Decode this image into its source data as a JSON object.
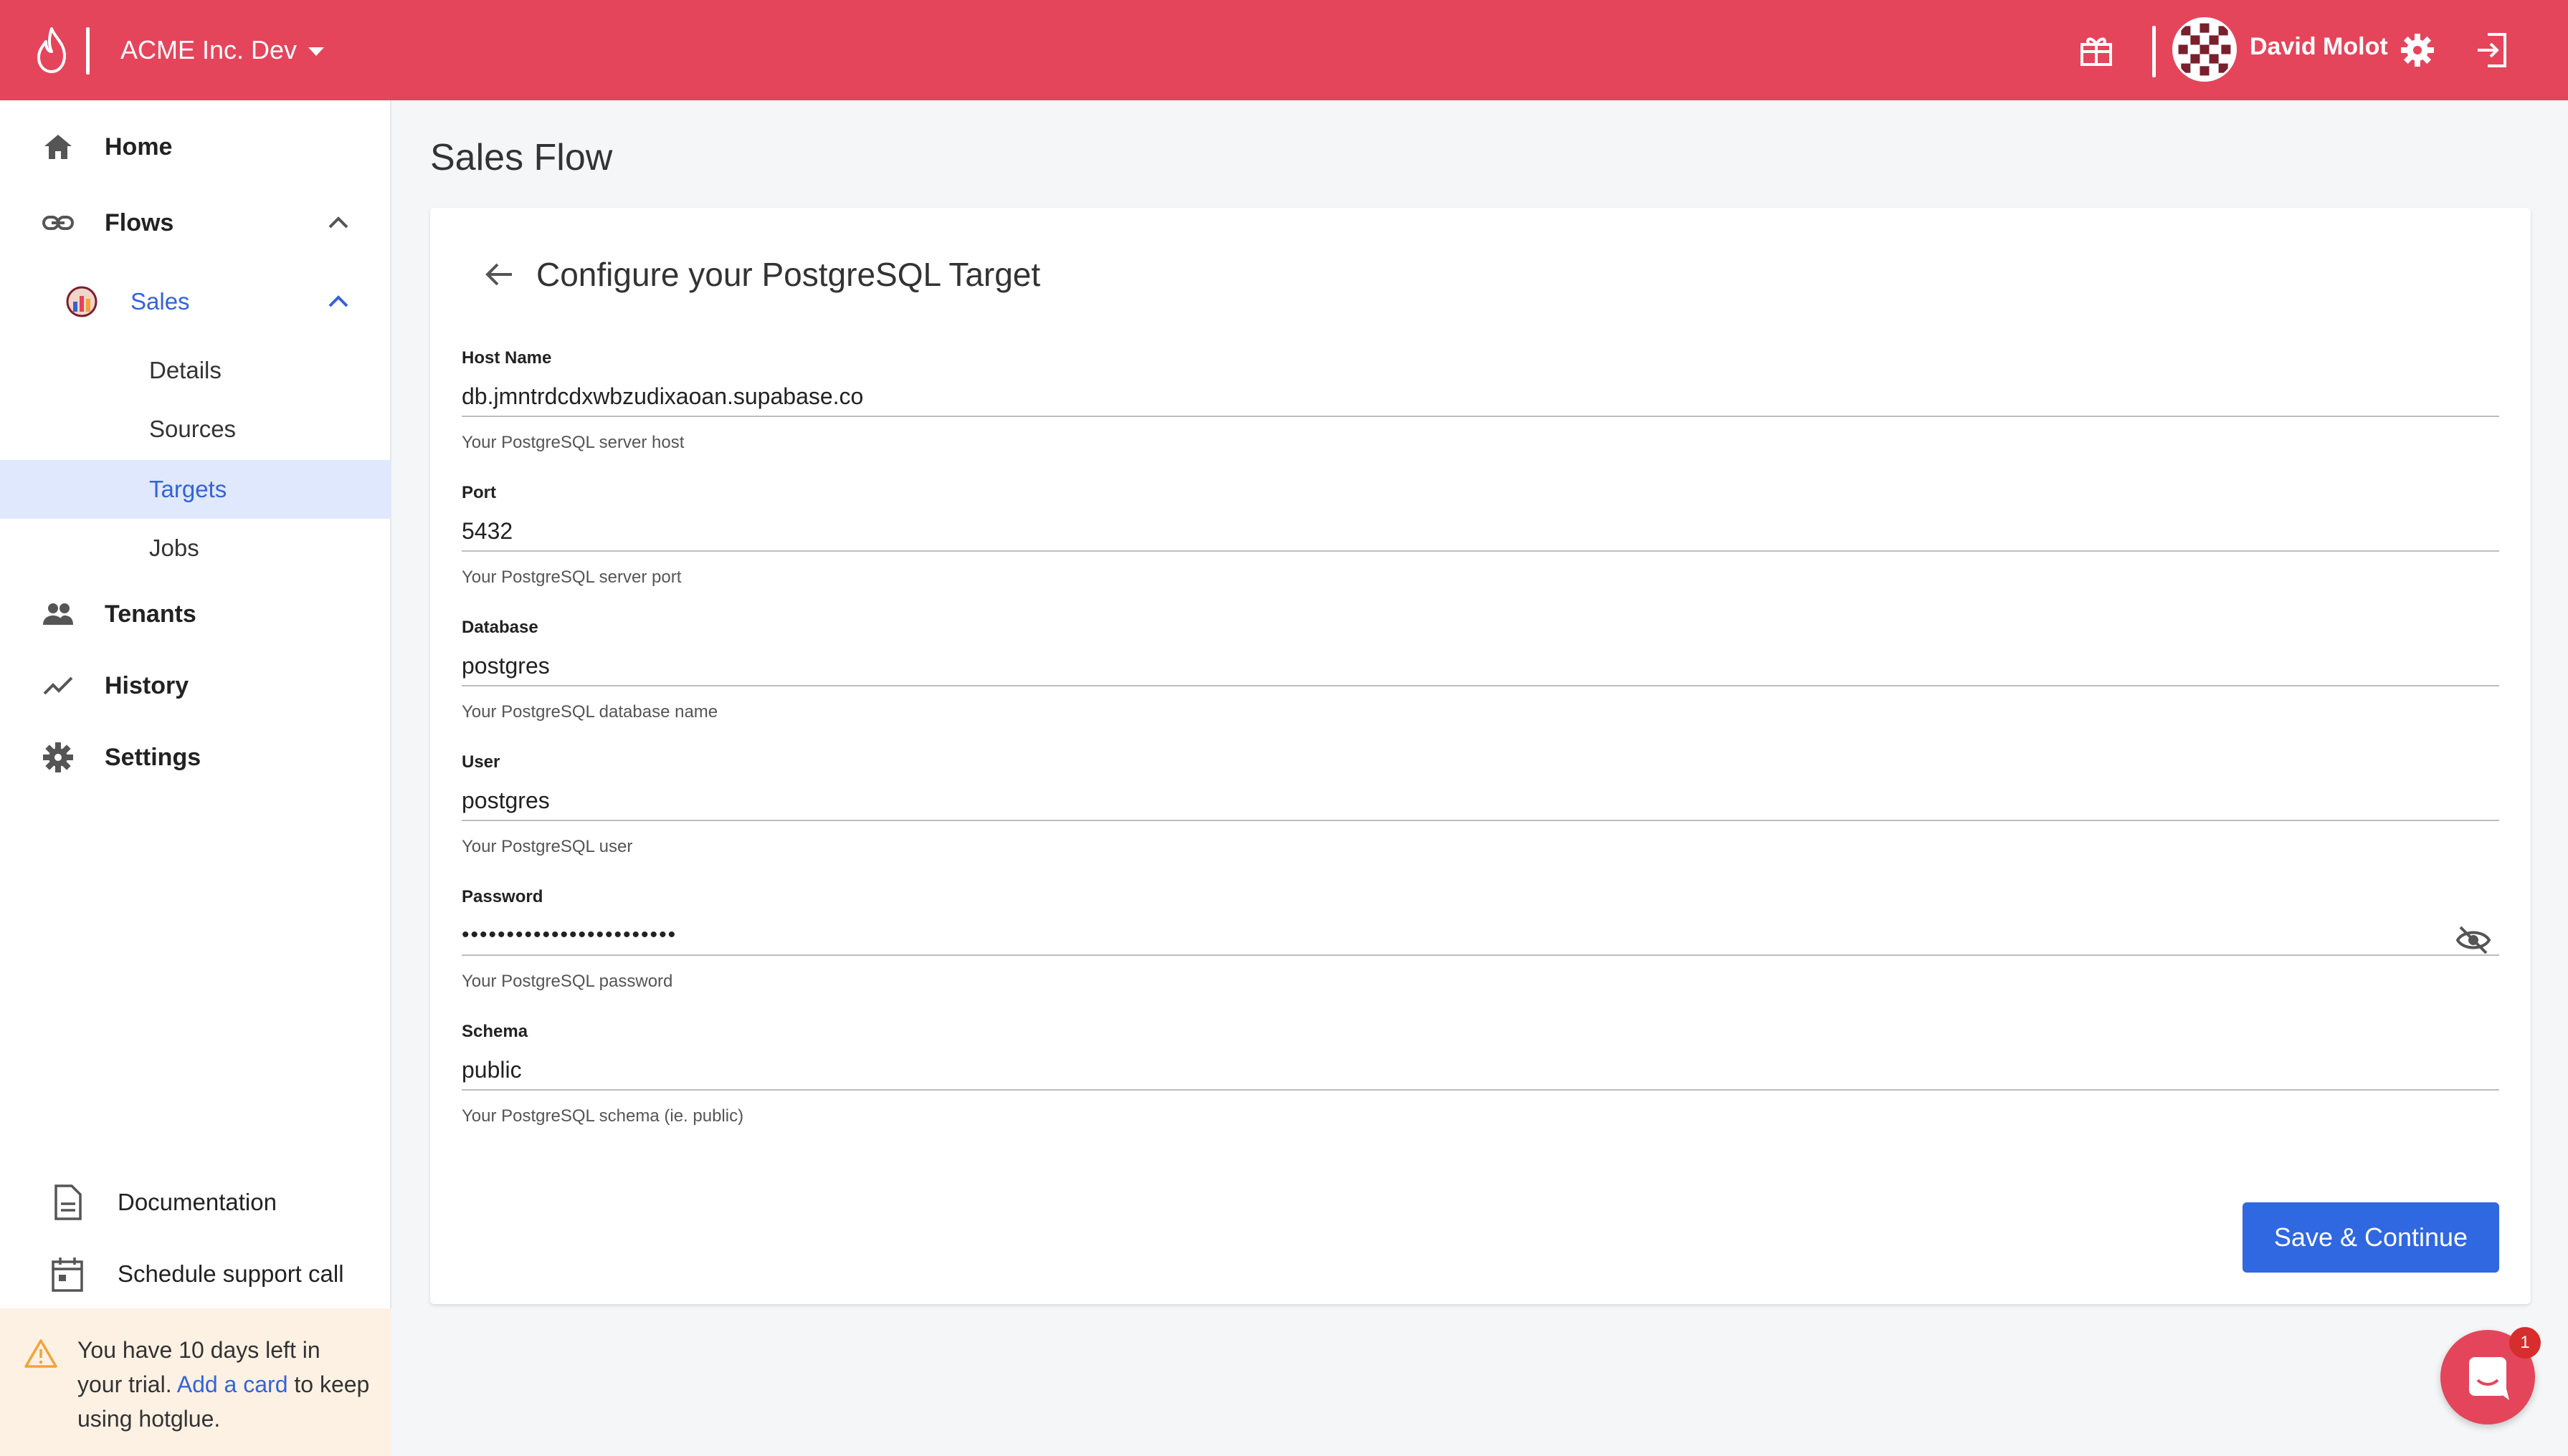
{
  "colors": {
    "brand": "#e4455b",
    "accent": "#2f68e0",
    "active_bg": "#dfe8fd",
    "trial_bg": "#fdf1e4"
  },
  "header": {
    "org_name": "ACME Inc. Dev",
    "user_name": "David Molot",
    "icons": [
      "flame-logo-icon",
      "gift-icon",
      "gear-icon",
      "logout-icon"
    ]
  },
  "sidebar": {
    "home": "Home",
    "flows": "Flows",
    "sales": "Sales",
    "sub": {
      "details": "Details",
      "sources": "Sources",
      "targets": "Targets",
      "jobs": "Jobs"
    },
    "tenants": "Tenants",
    "history": "History",
    "settings": "Settings",
    "documentation": "Documentation",
    "support": "Schedule support call",
    "trial": {
      "pre": "You have 10 days left in your trial.",
      "link": "Add a card",
      "post": "to keep using hotglue."
    }
  },
  "main": {
    "page_title": "Sales Flow",
    "card_title": "Configure your PostgreSQL Target",
    "fields": {
      "host": {
        "label": "Host Name",
        "value": "db.jmntrdcdxwbzudixaoan.supabase.co",
        "help": "Your PostgreSQL server host"
      },
      "port": {
        "label": "Port",
        "value": "5432",
        "help": "Your PostgreSQL server port"
      },
      "database": {
        "label": "Database",
        "value": "postgres",
        "help": "Your PostgreSQL database name"
      },
      "user": {
        "label": "User",
        "value": "postgres",
        "help": "Your PostgreSQL user"
      },
      "password": {
        "label": "Password",
        "value": "••••••••••••••••••••••••",
        "help": "Your PostgreSQL password"
      },
      "schema": {
        "label": "Schema",
        "value": "public",
        "help": "Your PostgreSQL schema (ie. public)"
      }
    },
    "save_label": "Save & Continue"
  },
  "chat": {
    "badge": "1"
  }
}
